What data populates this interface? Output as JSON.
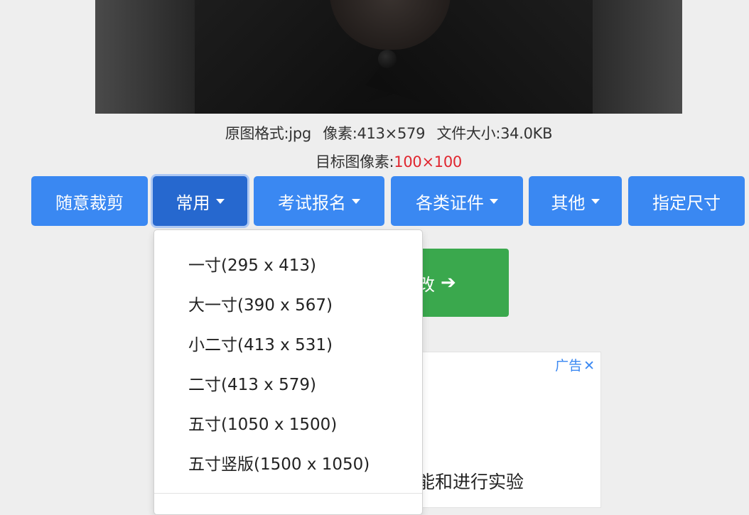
{
  "image_info": {
    "format_label": "原图格式:jpg",
    "pixels_label": "像素:413×579",
    "filesize_label": "文件大小:34.0KB",
    "target_label": "目标图像素:",
    "target_value": "100×100"
  },
  "toolbar": {
    "free_crop": "随意裁剪",
    "common": "常用",
    "exam": "考试报名",
    "certificates": "各类证件",
    "other": "其他",
    "custom_size": "指定尺寸"
  },
  "dropdown": {
    "items": [
      "一寸(295 x 413)",
      "大一寸(390 x 567)",
      "小二寸(413 x 531)",
      "二寸(413 x 579)",
      "五寸(1050 x 1500)",
      "五寸竖版(1500 x 1050)"
    ]
  },
  "action_button": {
    "label": "改"
  },
  "ad": {
    "label": "广告",
    "close": "✕",
    "text": "能和进行实验"
  },
  "colors": {
    "primary": "#3a88f2",
    "primary_active": "#2668cf",
    "success": "#3aa84d",
    "highlight": "#e0262f"
  }
}
